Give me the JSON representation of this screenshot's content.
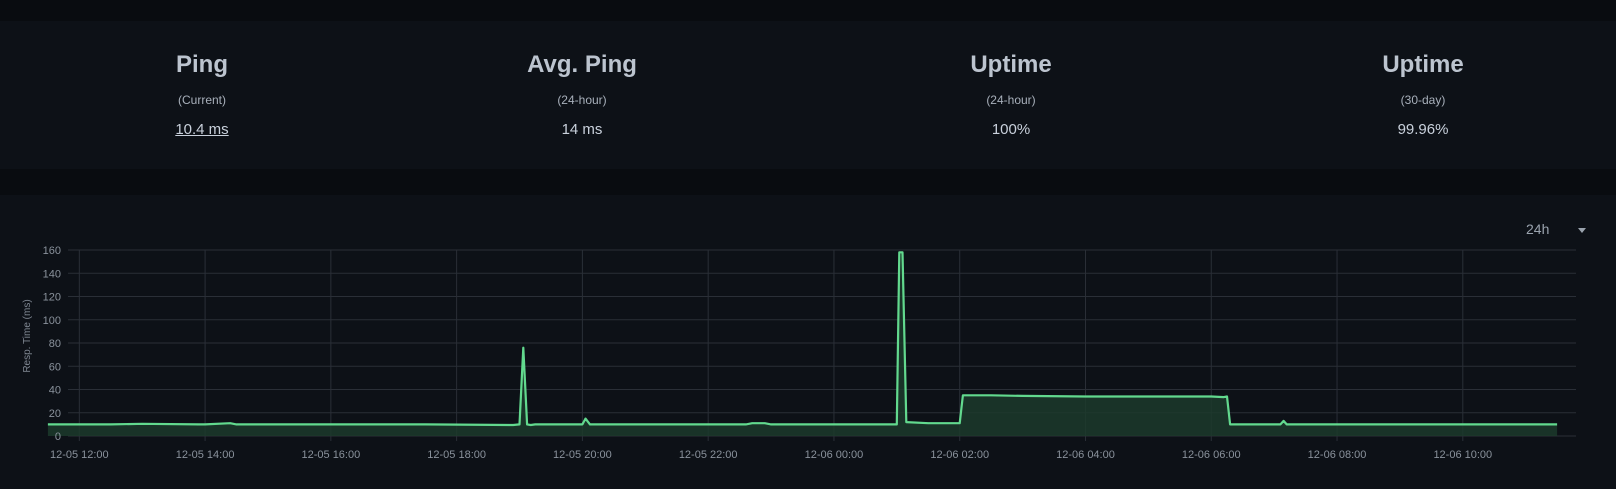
{
  "stats": [
    {
      "title": "Ping",
      "sub": "(Current)",
      "value": "10.4 ms"
    },
    {
      "title": "Avg. Ping",
      "sub": "(24-hour)",
      "value": "14 ms"
    },
    {
      "title": "Uptime",
      "sub": "(24-hour)",
      "value": "100%"
    },
    {
      "title": "Uptime",
      "sub": "(30-day)",
      "value": "99.96%"
    }
  ],
  "period": {
    "label": "24h"
  },
  "colors": {
    "line": "#62d98e",
    "fill": "#1c3a2b",
    "grid": "#2a2f37",
    "tick": "#8a929c"
  },
  "chart_data": {
    "type": "area",
    "ylabel": "Resp. Time (ms)",
    "ylim": [
      0,
      160
    ],
    "yticks": [
      0,
      20,
      40,
      60,
      80,
      100,
      120,
      140,
      160
    ],
    "xlim": [
      11.82,
      35.8
    ],
    "xtick_values": [
      12,
      14,
      16,
      18,
      20,
      22,
      24,
      26,
      28,
      30,
      32,
      34
    ],
    "xtick_labels": [
      "12-05 12:00",
      "12-05 14:00",
      "12-05 16:00",
      "12-05 18:00",
      "12-05 20:00",
      "12-05 22:00",
      "12-06 00:00",
      "12-06 02:00",
      "12-06 04:00",
      "12-06 06:00",
      "12-06 08:00",
      "12-06 10:00"
    ],
    "grid": true,
    "series": [
      {
        "x": [
          11.5,
          12.5,
          13.0,
          13.9,
          14.0,
          14.4,
          14.5,
          16.0,
          17.5,
          18.9,
          19.0,
          19.06,
          19.12,
          19.18,
          19.25,
          19.5,
          19.9,
          20.0,
          20.05,
          20.12,
          20.2,
          21.0,
          22.6,
          22.7,
          22.9,
          23.0,
          24.5,
          24.95,
          25.0,
          25.04,
          25.09,
          25.15,
          25.5,
          26.0,
          26.05,
          26.12,
          26.5,
          27.0,
          28.0,
          29.0,
          30.0,
          30.2,
          30.25,
          30.3,
          30.4,
          31.0,
          31.1,
          31.15,
          31.2,
          31.3,
          32.0,
          33.0,
          33.7,
          34.0,
          35.5
        ],
        "y": [
          10,
          10,
          10.5,
          10,
          10,
          11,
          10,
          10,
          10,
          9.5,
          10,
          76,
          10,
          9.5,
          10,
          10,
          10,
          10,
          15,
          10,
          10,
          10,
          10,
          11,
          11,
          10,
          10,
          10,
          10,
          158,
          158,
          12,
          11,
          11,
          35,
          35,
          35,
          34.5,
          34,
          34,
          34,
          33.5,
          34,
          10,
          10,
          10,
          10,
          13,
          10,
          10,
          10,
          10,
          10,
          10,
          10
        ]
      }
    ]
  }
}
